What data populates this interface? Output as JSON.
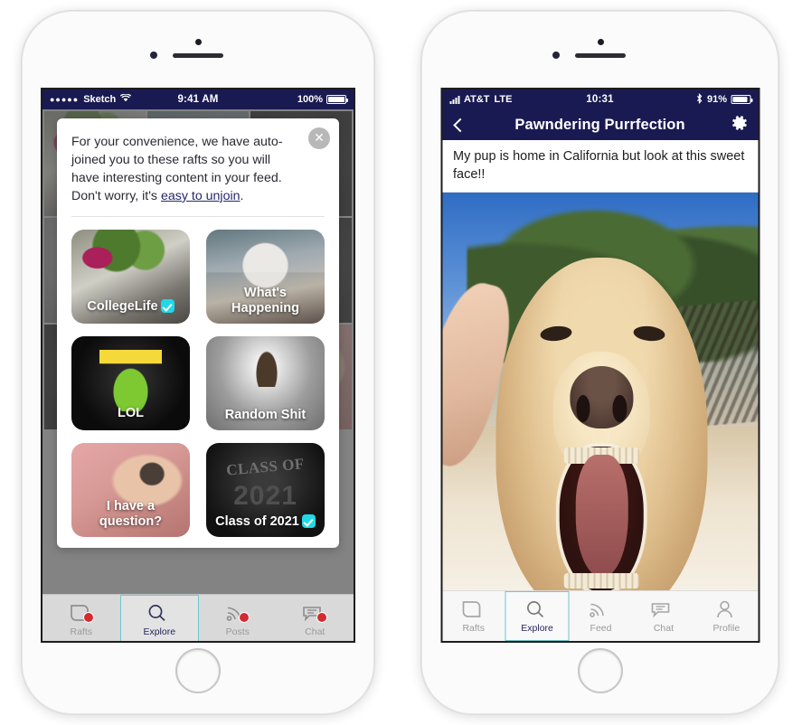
{
  "left_phone": {
    "status_bar": {
      "carrier": "Sketch",
      "signal_dots": "●●●●●",
      "time": "9:41 AM",
      "battery_text": "100%"
    },
    "modal": {
      "text_part1": "For your convenience, we have auto-joined you to these rafts so you will have interesting content in your feed. Don't worry, it's ",
      "link_text": "easy to unjoin",
      "text_part2": ".",
      "close_icon": "close-icon",
      "close_glyph": "✕"
    },
    "rafts": [
      {
        "label": "CollegeLife",
        "verified": true
      },
      {
        "label": "What's Happening",
        "verified": false
      },
      {
        "label": "LOL",
        "verified": false
      },
      {
        "label": "Random Shit",
        "verified": false
      },
      {
        "label": "I have a question?",
        "verified": false
      },
      {
        "label": "Class of 2021",
        "verified": true
      }
    ],
    "tabs": [
      {
        "label": "Rafts",
        "icon": "raft-icon",
        "active": false,
        "badge": true
      },
      {
        "label": "Explore",
        "icon": "search-icon",
        "active": true,
        "badge": false
      },
      {
        "label": "Posts",
        "icon": "rss-icon",
        "active": false,
        "badge": true
      },
      {
        "label": "Chat",
        "icon": "chat-icon",
        "active": false,
        "badge": true
      }
    ]
  },
  "right_phone": {
    "status_bar": {
      "carrier": "AT&T",
      "network": "LTE",
      "time": "10:31",
      "battery_text": "91%",
      "bluetooth_glyph": "✻"
    },
    "navbar": {
      "title": "Pawndering Purrfection",
      "back_icon": "back-chevron-icon",
      "settings_icon": "gear-icon"
    },
    "post": {
      "caption": "My pup is home in California but look at this sweet face!!",
      "image_alt": "yawning-yellow-labrador-photo"
    },
    "tabs": [
      {
        "label": "Rafts",
        "icon": "raft-icon",
        "active": false
      },
      {
        "label": "Explore",
        "icon": "search-icon",
        "active": true
      },
      {
        "label": "Feed",
        "icon": "rss-icon",
        "active": false
      },
      {
        "label": "Chat",
        "icon": "chat-icon",
        "active": false
      },
      {
        "label": "Profile",
        "icon": "person-icon",
        "active": false
      }
    ]
  },
  "colors": {
    "navy": "#1a1a52",
    "accent_teal": "#20d8e8",
    "selected_border": "#6fc7cf",
    "badge_red": "#d42b32",
    "link": "#27276b"
  }
}
